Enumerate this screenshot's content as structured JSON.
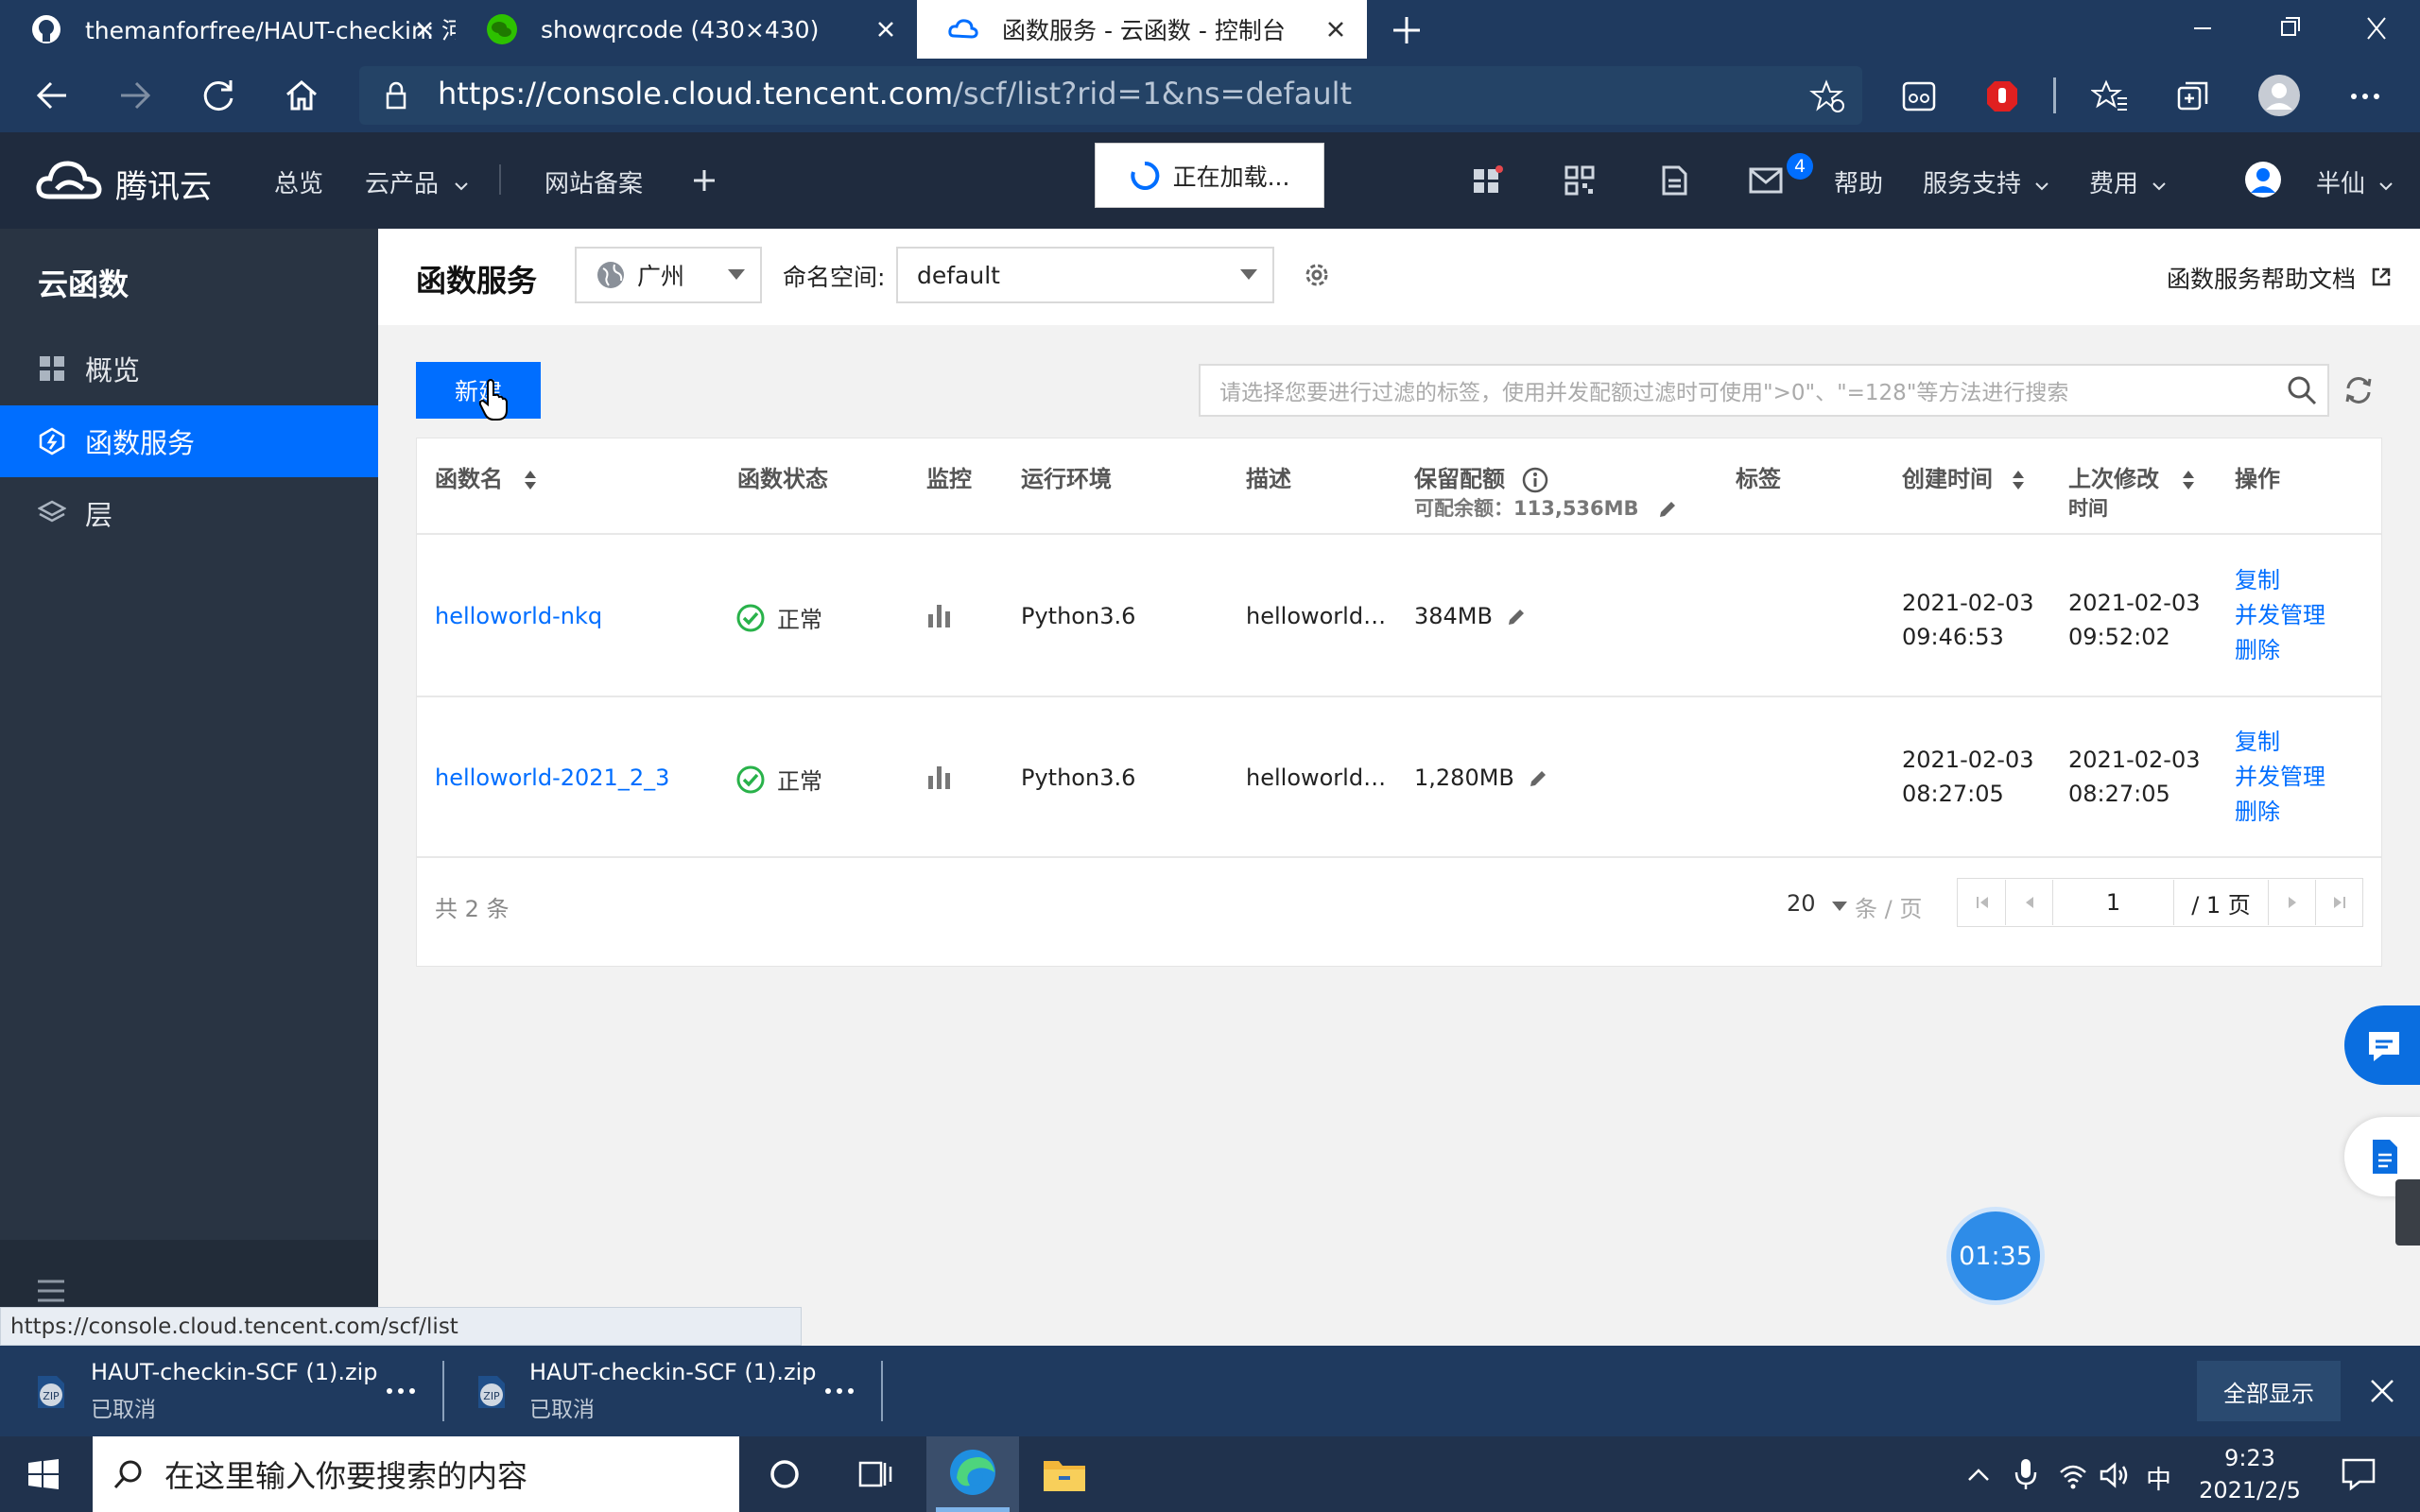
{
  "browser": {
    "tabs": [
      {
        "title": "themanforfree/HAUT-checkin: 河"
      },
      {
        "title": "showqrcode (430×430)"
      },
      {
        "title": "函数服务 - 云函数 - 控制台"
      }
    ],
    "url_host": "https://console.cloud.tencent.com",
    "url_path": "/scf/list?rid=1&ns=default",
    "status_url": "https://console.cloud.tencent.com/scf/list"
  },
  "header": {
    "brand": "腾讯云",
    "nav": [
      "总览",
      "云产品",
      "网站备案"
    ],
    "loading": "正在加载...",
    "mail_badge": "4",
    "help": "帮助",
    "support": "服务支持",
    "fee": "费用",
    "user": "半仙"
  },
  "sidebar": {
    "title": "云函数",
    "items": [
      {
        "label": "概览"
      },
      {
        "label": "函数服务"
      },
      {
        "label": "层"
      }
    ]
  },
  "page": {
    "title": "函数服务",
    "region": "广州",
    "namespace_label": "命名空间:",
    "namespace": "default",
    "help_doc": "函数服务帮助文档",
    "new_button": "新建",
    "search_placeholder": "请选择您要进行过滤的标签，使用并发配额过滤时可使用\">0\"、\"=128\"等方法进行搜索"
  },
  "table": {
    "headers": {
      "name": "函数名",
      "status": "函数状态",
      "monitor": "监控",
      "runtime": "运行环境",
      "desc": "描述",
      "reserved": "保留配额",
      "reserved_sub": "可配余额：113,536MB",
      "tags": "标签",
      "created": "创建时间",
      "modified_1": "上次修改",
      "modified_2": "时间",
      "actions": "操作"
    },
    "rows": [
      {
        "name": "helloworld-nkq",
        "status": "正常",
        "runtime": "Python3.6",
        "desc": "helloworld…",
        "reserved": "384MB",
        "created_date": "2021-02-03",
        "created_time": "09:46:53",
        "modified_date": "2021-02-03",
        "modified_time": "09:52:02",
        "actions": [
          "复制",
          "并发管理",
          "删除"
        ]
      },
      {
        "name": "helloworld-2021_2_3",
        "status": "正常",
        "runtime": "Python3.6",
        "desc": "helloworld…",
        "reserved": "1,280MB",
        "created_date": "2021-02-03",
        "created_time": "08:27:05",
        "modified_date": "2021-02-03",
        "modified_time": "08:27:05",
        "actions": [
          "复制",
          "并发管理",
          "删除"
        ]
      }
    ]
  },
  "pager": {
    "total": "共 2 条",
    "page_size": "20",
    "unit": "条 / 页",
    "current": "1",
    "pages": "/ 1 页"
  },
  "timer": "01:35",
  "downloads": [
    {
      "name": "HAUT-checkin-SCF (1).zip",
      "status": "已取消"
    },
    {
      "name": "HAUT-checkin-SCF (1).zip",
      "status": "已取消"
    }
  ],
  "show_all": "全部显示",
  "taskbar": {
    "search_placeholder": "在这里输入你要搜索的内容",
    "ime": "中",
    "time": "9:23",
    "date": "2021/2/5"
  },
  "colors": {
    "accent": "#006eff",
    "header_bg": "#1f2b3e",
    "sidebar_bg": "#293443",
    "ok_green": "#29b24a"
  }
}
